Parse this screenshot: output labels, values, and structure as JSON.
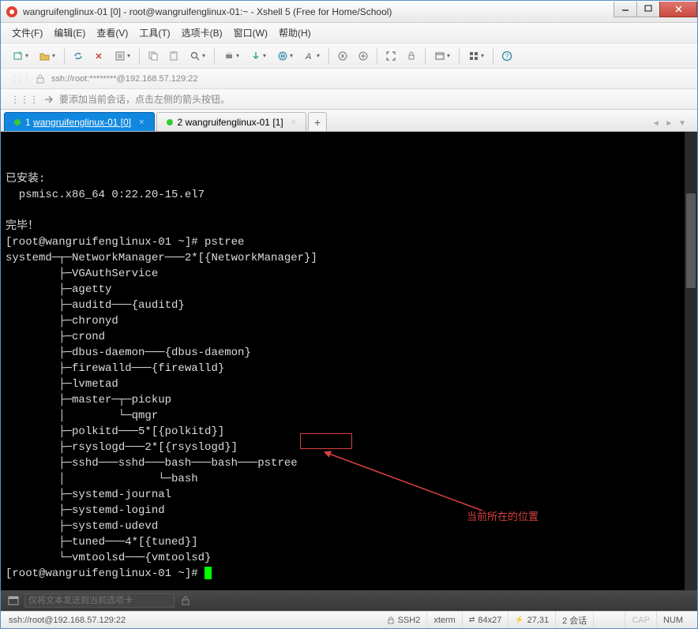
{
  "title": "wangruifenglinux-01 [0] - root@wangruifenglinux-01:~ - Xshell 5 (Free for Home/School)",
  "menu": [
    "文件(F)",
    "编辑(E)",
    "查看(V)",
    "工具(T)",
    "选项卡(B)",
    "窗口(W)",
    "帮助(H)"
  ],
  "address": "ssh://root:********@192.168.57.129:22",
  "hint": "要添加当前会话，点击左侧的箭头按钮。",
  "tabs": [
    {
      "num": "1",
      "name": "wangruifenglinux-01 [0]",
      "active": true
    },
    {
      "num": "2",
      "name": "wangruifenglinux-01 [1]",
      "active": false
    }
  ],
  "term": {
    "lines": [
      "",
      "已安装:",
      "  psmisc.x86_64 0:22.20-15.el7",
      "",
      "完毕！",
      "[root@wangruifenglinux-01 ~]# pstree",
      "systemd─┬─NetworkManager───2*[{NetworkManager}]",
      "        ├─VGAuthService",
      "        ├─agetty",
      "        ├─auditd───{auditd}",
      "        ├─chronyd",
      "        ├─crond",
      "        ├─dbus-daemon───{dbus-daemon}",
      "        ├─firewalld───{firewalld}",
      "        ├─lvmetad",
      "        ├─master─┬─pickup",
      "        │        └─qmgr",
      "        ├─polkitd───5*[{polkitd}]",
      "        ├─rsyslogd───2*[{rsyslogd}]",
      "        ├─sshd───sshd───bash───bash───pstree",
      "        │              └─bash",
      "        ├─systemd-journal",
      "        ├─systemd-logind",
      "        ├─systemd-udevd",
      "        ├─tuned───4*[{tuned}]",
      "        └─vmtoolsd───{vmtoolsd}"
    ],
    "prompt": "[root@wangruifenglinux-01 ~]# "
  },
  "annotation": "当前所在的位置",
  "send_placeholder": "仅将文本发送到当前选项卡",
  "status": {
    "left": "ssh://root@192.168.57.129:22",
    "ssh": "SSH2",
    "term": "xterm",
    "size": "84x27",
    "pos": "27,31",
    "sess": "2 会话",
    "cap": "CAP",
    "num": "NUM"
  }
}
